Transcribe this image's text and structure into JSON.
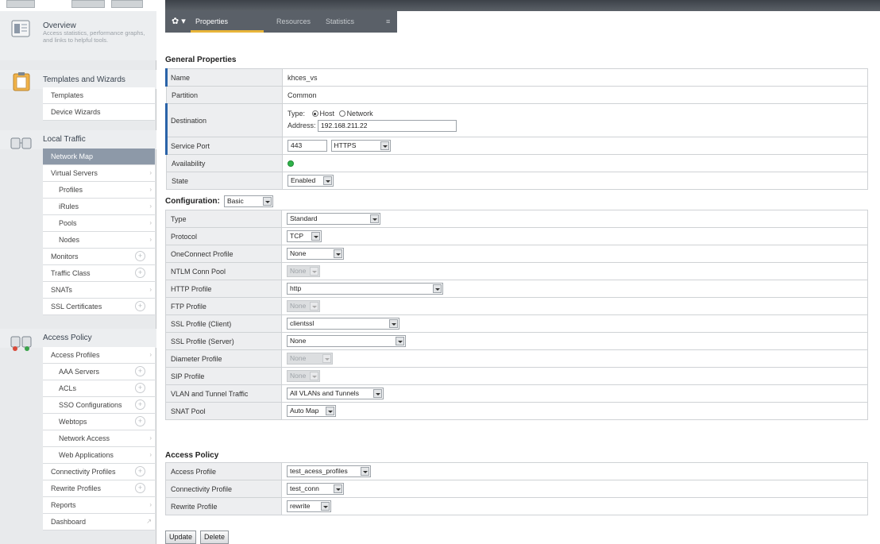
{
  "sidebar": {
    "overview": {
      "title": "Overview",
      "desc": "Access statistics, performance graphs, and links to helpful tools."
    },
    "templates": {
      "title": "Templates and Wizards",
      "items": [
        {
          "label": "Templates"
        },
        {
          "label": "Device Wizards"
        }
      ]
    },
    "local_traffic": {
      "title": "Local Traffic",
      "items": [
        {
          "label": "Network Map"
        },
        {
          "label": "Virtual Servers"
        },
        {
          "label": "Profiles"
        },
        {
          "label": "iRules"
        },
        {
          "label": "Pools"
        },
        {
          "label": "Nodes"
        },
        {
          "label": "Monitors"
        },
        {
          "label": "Traffic Class"
        },
        {
          "label": "SNATs"
        },
        {
          "label": "SSL Certificates"
        }
      ]
    },
    "access_policy": {
      "title": "Access Policy",
      "items": [
        {
          "label": "Access Profiles"
        },
        {
          "label": "AAA Servers"
        },
        {
          "label": "ACLs"
        },
        {
          "label": "SSO Configurations"
        },
        {
          "label": "Webtops"
        },
        {
          "label": "Network Access"
        },
        {
          "label": "Web Applications"
        },
        {
          "label": "Connectivity Profiles"
        },
        {
          "label": "Rewrite Profiles"
        },
        {
          "label": "Reports"
        },
        {
          "label": "Dashboard"
        }
      ]
    }
  },
  "tabs": {
    "gear": "✿ ▾",
    "properties": "Properties",
    "resources": "Resources",
    "statistics": "Statistics",
    "extra": "≡"
  },
  "general": {
    "title": "General Properties",
    "name_label": "Name",
    "name_value": "khces_vs",
    "partition_label": "Partition",
    "partition_value": "Common",
    "destination_label": "Destination",
    "type_label": "Type:",
    "host_label": "Host",
    "network_label": "Network",
    "address_label": "Address:",
    "address_value": "192.168.211.22",
    "service_port_label": "Service Port",
    "port_value": "443",
    "port_protocol": "HTTPS",
    "availability_label": "Availability",
    "state_label": "State",
    "state_value": "Enabled"
  },
  "configuration": {
    "title": "Configuration:",
    "mode": "Basic",
    "rows": [
      {
        "label": "Type",
        "value": "Standard"
      },
      {
        "label": "Protocol",
        "value": "TCP"
      },
      {
        "label": "OneConnect Profile",
        "value": "None"
      },
      {
        "label": "NTLM Conn Pool",
        "value": "None"
      },
      {
        "label": "HTTP Profile",
        "value": "http"
      },
      {
        "label": "FTP Profile",
        "value": "None"
      },
      {
        "label": "SSL Profile (Client)",
        "value": "clientssl"
      },
      {
        "label": "SSL Profile (Server)",
        "value": "None"
      },
      {
        "label": "Diameter Profile",
        "value": "None"
      },
      {
        "label": "SIP Profile",
        "value": "None"
      },
      {
        "label": "VLAN and Tunnel Traffic",
        "value": "All VLANs and Tunnels"
      },
      {
        "label": "SNAT Pool",
        "value": "Auto Map"
      }
    ]
  },
  "access": {
    "title": "Access Policy",
    "rows": [
      {
        "label": "Access Profile",
        "value": "test_acess_profiles"
      },
      {
        "label": "Connectivity Profile",
        "value": "test_conn"
      },
      {
        "label": "Rewrite Profile",
        "value": "rewrite"
      }
    ]
  },
  "buttons": {
    "update": "Update",
    "delete": "Delete"
  }
}
